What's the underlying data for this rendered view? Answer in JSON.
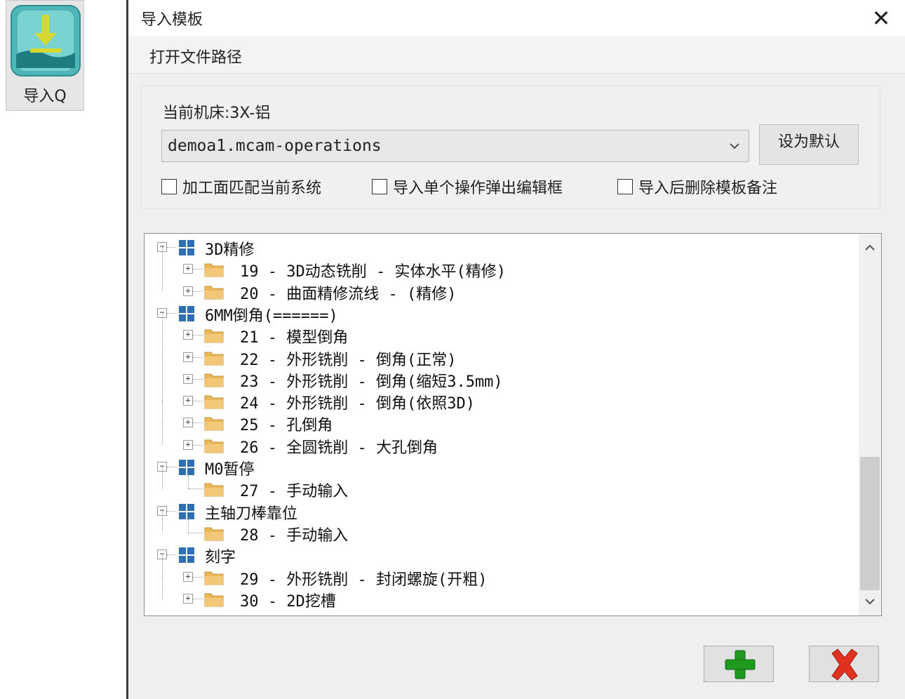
{
  "toolbar": {
    "import_label": "导入Q"
  },
  "dialog": {
    "title": "导入模板",
    "close_symbol": "✕",
    "menu": {
      "open_path": "打开文件路径"
    },
    "machine_label": "当前机床:3X-铝",
    "combo_value": "demoa1.mcam-operations",
    "set_default_label": "设为默认",
    "checkboxes": [
      {
        "label": "加工面匹配当前系统",
        "checked": false
      },
      {
        "label": "导入单个操作弹出编辑框",
        "checked": false
      },
      {
        "label": "导入后删除模板备注",
        "checked": false
      }
    ],
    "tree": {
      "groups": [
        {
          "label": "3D精修",
          "children": [
            "19 - 3D动态铣削 - 实体水平(精修)",
            "20 - 曲面精修流线 - (精修)"
          ]
        },
        {
          "label": "6MM倒角(======)",
          "children": [
            "21 - 模型倒角",
            "22 - 外形铣削 - 倒角(正常)",
            "23 - 外形铣削 - 倒角(缩短3.5mm)",
            "24 - 外形铣削 - 倒角(依照3D)",
            "25 - 孔倒角",
            "26 - 全圆铣削 - 大孔倒角"
          ]
        },
        {
          "label": "M0暂停",
          "children": [
            "27 - 手动输入"
          ]
        },
        {
          "label": "主轴刀棒靠位",
          "children": [
            "28 - 手动输入"
          ]
        },
        {
          "label": "刻字",
          "children": [
            "29 - 外形铣削 - 封闭螺旋(开粗)",
            "30 - 2D挖槽"
          ]
        }
      ]
    },
    "buttons": {
      "ok_icon": "green-plus-icon",
      "cancel_icon": "red-x-icon"
    }
  },
  "colors": {
    "dialog_bg": "#efefef",
    "folder": "#e8b85a",
    "grid_icon": "#2e6fb2",
    "ok_green": "#1f9a1f",
    "cancel_red": "#e0301e",
    "tool_icon": "#4fb6b7"
  }
}
